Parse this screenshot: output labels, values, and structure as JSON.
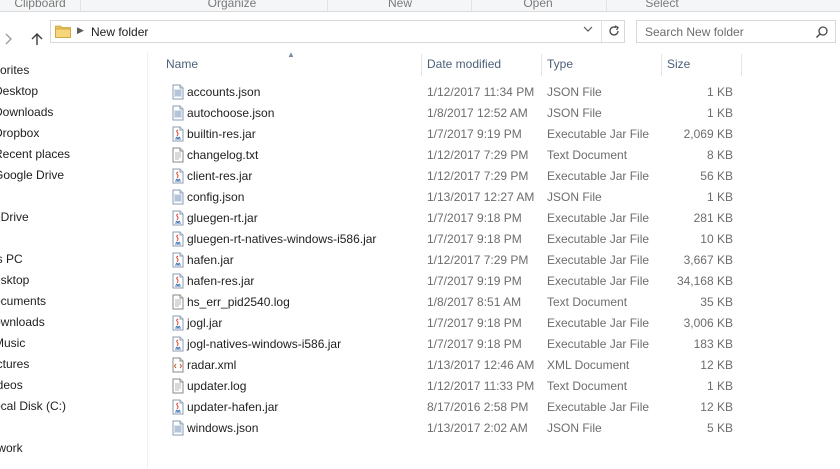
{
  "ribbon": {
    "groups": [
      "Clipboard",
      "Organize",
      "New",
      "Open",
      "Select"
    ]
  },
  "address": {
    "crumb": "New folder"
  },
  "search": {
    "placeholder": "Search New folder"
  },
  "nav": {
    "items": [
      "vorites",
      "Desktop",
      "Downloads",
      "Dropbox",
      "Recent places",
      "Google Drive",
      "eDrive",
      "is PC",
      "esktop",
      "ocuments",
      "ownloads",
      "Music",
      "ictures",
      "ideos",
      "ocal Disk (C:)",
      "twork"
    ]
  },
  "columns": {
    "name": "Name",
    "date": "Date modified",
    "type": "Type",
    "size": "Size"
  },
  "files": [
    {
      "name": "accounts.json",
      "date": "1/12/2017 11:34 PM",
      "type": "JSON File",
      "size": "1 KB",
      "icon": "json-file-icon"
    },
    {
      "name": "autochoose.json",
      "date": "1/8/2017 12:52 AM",
      "type": "JSON File",
      "size": "1 KB",
      "icon": "json-file-icon"
    },
    {
      "name": "builtin-res.jar",
      "date": "1/7/2017 9:19 PM",
      "type": "Executable Jar File",
      "size": "2,069 KB",
      "icon": "jar-file-icon"
    },
    {
      "name": "changelog.txt",
      "date": "1/12/2017 7:29 PM",
      "type": "Text Document",
      "size": "8 KB",
      "icon": "text-file-icon"
    },
    {
      "name": "client-res.jar",
      "date": "1/12/2017 7:29 PM",
      "type": "Executable Jar File",
      "size": "56 KB",
      "icon": "jar-file-icon"
    },
    {
      "name": "config.json",
      "date": "1/13/2017 12:27 AM",
      "type": "JSON File",
      "size": "1 KB",
      "icon": "json-file-icon"
    },
    {
      "name": "gluegen-rt.jar",
      "date": "1/7/2017 9:18 PM",
      "type": "Executable Jar File",
      "size": "281 KB",
      "icon": "jar-file-icon"
    },
    {
      "name": "gluegen-rt-natives-windows-i586.jar",
      "date": "1/7/2017 9:18 PM",
      "type": "Executable Jar File",
      "size": "10 KB",
      "icon": "jar-file-icon"
    },
    {
      "name": "hafen.jar",
      "date": "1/12/2017 7:29 PM",
      "type": "Executable Jar File",
      "size": "3,667 KB",
      "icon": "jar-file-icon"
    },
    {
      "name": "hafen-res.jar",
      "date": "1/7/2017 9:19 PM",
      "type": "Executable Jar File",
      "size": "34,168 KB",
      "icon": "jar-file-icon"
    },
    {
      "name": "hs_err_pid2540.log",
      "date": "1/8/2017 8:51 AM",
      "type": "Text Document",
      "size": "35 KB",
      "icon": "text-file-icon"
    },
    {
      "name": "jogl.jar",
      "date": "1/7/2017 9:18 PM",
      "type": "Executable Jar File",
      "size": "3,006 KB",
      "icon": "jar-file-icon"
    },
    {
      "name": "jogl-natives-windows-i586.jar",
      "date": "1/7/2017 9:18 PM",
      "type": "Executable Jar File",
      "size": "183 KB",
      "icon": "jar-file-icon"
    },
    {
      "name": "radar.xml",
      "date": "1/13/2017 12:46 AM",
      "type": "XML Document",
      "size": "12 KB",
      "icon": "xml-file-icon"
    },
    {
      "name": "updater.log",
      "date": "1/12/2017 11:33 PM",
      "type": "Text Document",
      "size": "1 KB",
      "icon": "text-file-icon"
    },
    {
      "name": "updater-hafen.jar",
      "date": "8/17/2016 2:58 PM",
      "type": "Executable Jar File",
      "size": "12 KB",
      "icon": "jar-file-icon"
    },
    {
      "name": "windows.json",
      "date": "1/13/2017 2:02 AM",
      "type": "JSON File",
      "size": "5 KB",
      "icon": "json-file-icon"
    }
  ],
  "colors": {
    "header_text": "#4c607a",
    "secondary_text": "#6d6d6d",
    "border": "#d9d9d9",
    "folder_yellow": "#e8c15a"
  }
}
